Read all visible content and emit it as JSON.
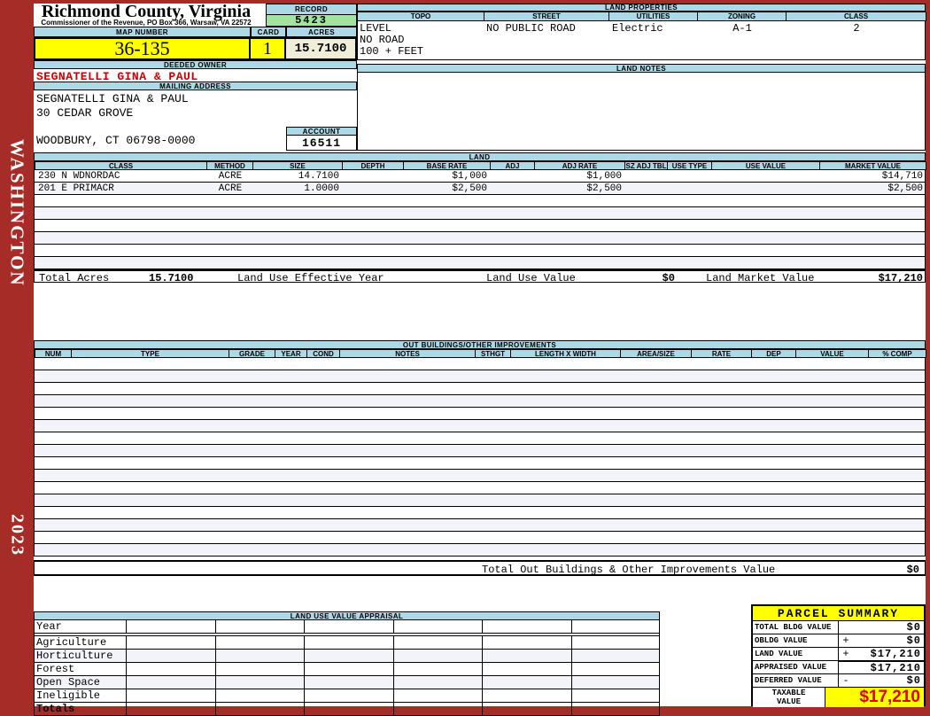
{
  "frame": {
    "county_label": "WASHINGTON",
    "year": "2023"
  },
  "header": {
    "title": "Richmond County, Virginia",
    "subtitle": "Commissioner of the Revenue, PO Box 366, Warsaw, VA 22572",
    "record": {
      "label": "RECORD",
      "value": "5423"
    },
    "map_number": {
      "label": "MAP NUMBER",
      "value": "36-135"
    },
    "card": {
      "label": "CARD",
      "value": "1"
    },
    "acres": {
      "label": "ACRES",
      "value": "15.7100"
    },
    "deeded_owner": {
      "label": "DEEDED OWNER",
      "value": "SEGNATELLI GINA & PAUL"
    },
    "mailing_address": {
      "label": "MAILING ADDRESS",
      "lines": [
        "SEGNATELLI GINA & PAUL",
        "30 CEDAR GROVE",
        "",
        "WOODBURY, CT 06798-0000"
      ]
    },
    "account": {
      "label": "ACCOUNT",
      "value": "16511"
    }
  },
  "land_properties": {
    "title": "LAND PROPERTIES",
    "columns": [
      "TOPO",
      "STREET",
      "UTILITIES",
      "ZONING",
      "CLASS"
    ],
    "topo_lines": [
      "LEVEL",
      "NO ROAD",
      "100 + FEET"
    ],
    "street": "NO PUBLIC ROAD",
    "utilities": "Electric",
    "zoning": "A-1",
    "class": "2"
  },
  "land_notes": {
    "title": "LAND NOTES"
  },
  "land": {
    "title": "LAND",
    "columns": [
      "CLASS",
      "METHOD",
      "SIZE",
      "DEPTH",
      "BASE RATE",
      "ADJ",
      "ADJ RATE",
      "SZ ADJ TBL",
      "USE TYPE",
      "USE VALUE",
      "MARKET VALUE"
    ],
    "rows": [
      [
        "230 N WDNORDAC",
        "ACRE",
        "14.7100",
        "",
        "$1,000",
        "",
        "$1,000",
        "",
        "",
        "",
        "$14,710"
      ],
      [
        "201 E PRIMACR",
        "ACRE",
        "1.0000",
        "",
        "$2,500",
        "",
        "$2,500",
        "",
        "",
        "",
        "$2,500"
      ]
    ],
    "empty_row_count": 6,
    "totals": {
      "total_acres_label": "Total Acres",
      "total_acres": "15.7100",
      "effective_year_label": "Land Use Effective Year",
      "use_value_label": "Land Use Value",
      "use_value": "$0",
      "market_value_label": "Land Market Value",
      "market_value": "$17,210"
    }
  },
  "out_buildings": {
    "title": "OUT BUILDINGS/OTHER IMPROVEMENTS",
    "columns": [
      "NUM",
      "TYPE",
      "GRADE",
      "YEAR",
      "COND",
      "NOTES",
      "STHGT",
      "LENGTH X WIDTH",
      "AREA/SIZE",
      "RATE",
      "DEP",
      "VALUE",
      "% COMP"
    ],
    "empty_row_count": 16,
    "total_label": "Total Out Buildings & Other Improvements Value",
    "total_value": "$0"
  },
  "land_use_appraisal": {
    "title": "LAND USE VALUE APPRAISAL",
    "row_labels": [
      "Year",
      "Agriculture",
      "Horticulture",
      "Forest",
      "Open Space",
      "Ineligible",
      "Totals"
    ],
    "column_count": 6
  },
  "parcel_summary": {
    "title": "PARCEL SUMMARY",
    "rows": [
      {
        "label": "TOTAL BLDG VALUE",
        "op": "",
        "value": "$0"
      },
      {
        "label": "OBLDG VALUE",
        "op": "+",
        "value": "$0"
      },
      {
        "label": "LAND VALUE",
        "op": "+",
        "value": "$17,210"
      },
      {
        "label": "APPRAISED VALUE",
        "op": "",
        "value": "$17,210"
      },
      {
        "label": "DEFERRED VALUE",
        "op": "-",
        "value": "$0"
      }
    ],
    "taxable": {
      "label_lines": [
        "TAXABLE",
        "VALUE"
      ],
      "value": "$17,210"
    }
  },
  "colors": {
    "frame_red": "#A62C28",
    "header_blue": "#ADD8E6",
    "record_green": "#A0E4A0",
    "highlight_yellow": "#FFFF00",
    "acres_ivory": "#EFEFD9",
    "owner_red": "#CC0000",
    "taxable_red": "#E00000"
  }
}
